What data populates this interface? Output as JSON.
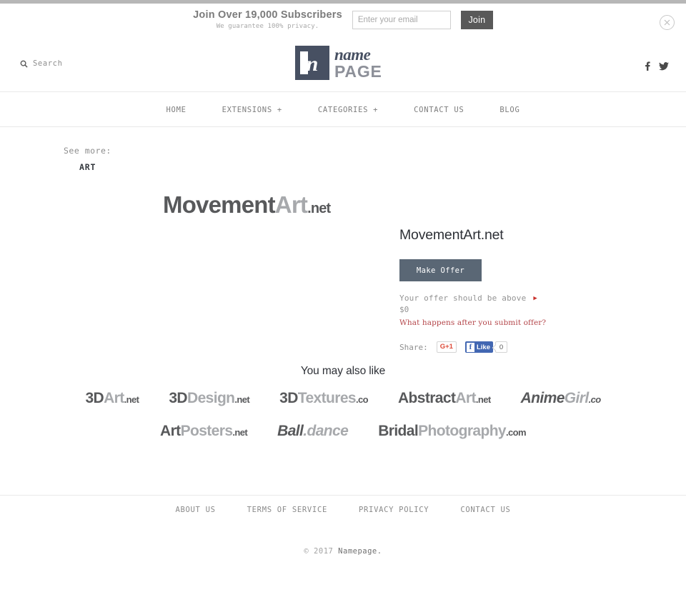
{
  "top_bar": {
    "headline": "Join Over 19,000 Subscribers",
    "subheadline": "We guarantee 100% privacy.",
    "email_placeholder": "Enter your email",
    "email_value": "",
    "join_label": "Join",
    "close_icon": "close-circle-icon"
  },
  "header": {
    "search_label": "Search",
    "search_icon": "search-icon",
    "logo_mark_letter": "n",
    "logo_word_top": "name",
    "logo_word_bottom": "PAGE",
    "social": [
      {
        "name": "facebook-icon",
        "glyph": "f"
      },
      {
        "name": "twitter-icon",
        "glyph": "t"
      }
    ]
  },
  "nav": {
    "items": [
      {
        "label": "HOME"
      },
      {
        "label": "EXTENSIONS +"
      },
      {
        "label": "CATEGORIES +"
      },
      {
        "label": "CONTACT US"
      },
      {
        "label": "BLOG"
      }
    ]
  },
  "breadcrumb": {
    "see_more_label": "See more:",
    "category": "ART"
  },
  "domain": {
    "logo_parts": [
      {
        "text": "Movement",
        "tone": "dark"
      },
      {
        "text": "Art",
        "tone": "light"
      },
      {
        "text": ".net",
        "tone": "tld"
      }
    ],
    "name": "MovementArt.net",
    "make_offer_label": "Make Offer",
    "offer_above_label": "Your offer should be above",
    "offer_above_amount": "$0",
    "what_happens_link": "What happens after you submit offer?",
    "arrow_icon": "arrow-right-icon"
  },
  "share": {
    "label": "Share:",
    "gplus_label": "G+1",
    "facebook_like_label": "Like",
    "facebook_count": "0"
  },
  "also_like": {
    "title": "You may also like",
    "rows": [
      [
        {
          "parts": [
            {
              "text": "3D",
              "tone": "dark"
            },
            {
              "text": "Art",
              "tone": "light"
            },
            {
              "text": ".net",
              "tone": "tld"
            }
          ],
          "italic": false
        },
        {
          "parts": [
            {
              "text": "3D",
              "tone": "dark"
            },
            {
              "text": "Design",
              "tone": "light"
            },
            {
              "text": ".net",
              "tone": "tld"
            }
          ],
          "italic": false
        },
        {
          "parts": [
            {
              "text": "3D",
              "tone": "dark"
            },
            {
              "text": "Textures",
              "tone": "light"
            },
            {
              "text": ".co",
              "tone": "tld"
            }
          ],
          "italic": false
        },
        {
          "parts": [
            {
              "text": "Abstract",
              "tone": "dark"
            },
            {
              "text": "Art",
              "tone": "light"
            },
            {
              "text": ".net",
              "tone": "tld"
            }
          ],
          "italic": false
        },
        {
          "parts": [
            {
              "text": "Anime",
              "tone": "dark"
            },
            {
              "text": "Girl",
              "tone": "light"
            },
            {
              "text": ".co",
              "tone": "tld"
            }
          ],
          "italic": true
        }
      ],
      [
        {
          "parts": [
            {
              "text": "Art",
              "tone": "dark"
            },
            {
              "text": "Posters",
              "tone": "light"
            },
            {
              "text": ".net",
              "tone": "tld"
            }
          ],
          "italic": false
        },
        {
          "parts": [
            {
              "text": "Ball",
              "tone": "dark"
            },
            {
              "text": ".dance",
              "tone": "light"
            }
          ],
          "italic": true
        },
        {
          "parts": [
            {
              "text": "Bridal",
              "tone": "dark"
            },
            {
              "text": "Photography",
              "tone": "light"
            },
            {
              "text": ".com",
              "tone": "tld"
            }
          ],
          "italic": false
        }
      ]
    ]
  },
  "footer": {
    "links": [
      {
        "label": "ABOUT US"
      },
      {
        "label": "TERMS OF SERVICE"
      },
      {
        "label": "PRIVACY POLICY"
      },
      {
        "label": "CONTACT US"
      }
    ],
    "copyright_prefix": "© 2017 ",
    "copyright_brand": "Namepage."
  },
  "colors": {
    "logo_mark": "#475062",
    "make_offer_button": "#5a6775",
    "join_button": "#595959",
    "link_red": "#b4464a",
    "gplus_red": "#dd4b39",
    "facebook_blue": "#4267b2",
    "domain_dark": "#58595b",
    "domain_light": "#a7a9ac"
  }
}
